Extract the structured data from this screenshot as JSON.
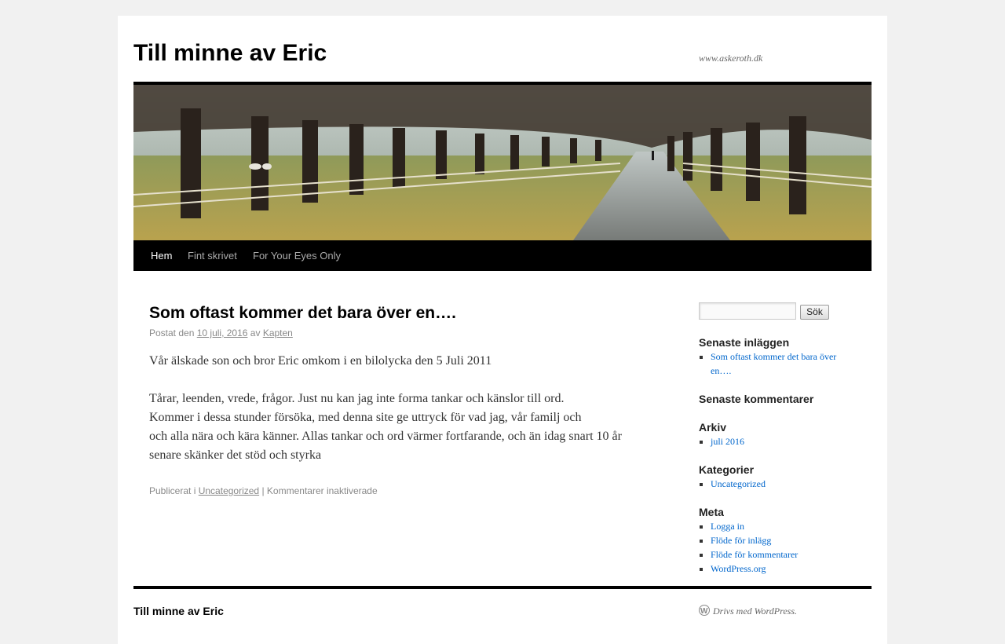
{
  "header": {
    "site_title": "Till minne av Eric",
    "site_description": "www.askeroth.dk",
    "banner_icon": "header-image"
  },
  "nav": {
    "items": [
      {
        "label": "Hem",
        "current": true
      },
      {
        "label": "Fint skrivet",
        "current": false
      },
      {
        "label": "For Your Eyes Only",
        "current": false
      }
    ]
  },
  "post": {
    "title": "Som oftast kommer det bara över en….",
    "meta_prefix": "Postat den",
    "date": "10 juli, 2016",
    "meta_by": "av",
    "author": "Kapten",
    "paragraphs": [
      "Vår älskade son och bror Eric omkom i en bilolycka den 5 Juli 2011",
      "Tårar, leenden, vrede, frågor. Just nu kan jag inte forma tankar och känslor till ord.",
      "Kommer i dessa stunder försöka, med denna site ge uttryck för vad jag, vår familj och",
      "och alla nära och kära känner. Allas tankar och ord värmer fortfarande, och än idag snart 10 år",
      "senare skänker det stöd och styrka"
    ],
    "utility_prefix": "Publicerat i",
    "category": "Uncategorized",
    "separator": "|",
    "comments_status": "Kommentarer inaktiverade"
  },
  "sidebar": {
    "search": {
      "value": "",
      "button_label": "Sök"
    },
    "recent_posts": {
      "title": "Senaste inläggen",
      "items": [
        "Som oftast kommer det bara över en…."
      ]
    },
    "recent_comments": {
      "title": "Senaste kommentarer"
    },
    "archive": {
      "title": "Arkiv",
      "items": [
        "juli 2016"
      ]
    },
    "categories": {
      "title": "Kategorier",
      "items": [
        "Uncategorized"
      ]
    },
    "meta": {
      "title": "Meta",
      "items": [
        "Logga in",
        "Flöde för inlägg",
        "Flöde för kommentarer",
        "WordPress.org"
      ]
    }
  },
  "footer": {
    "site_title": "Till minne av Eric",
    "powered_by": "Drivs med WordPress.",
    "powered_icon": "wordpress-icon"
  },
  "colors": {
    "link": "#0066cc",
    "nav_bg": "#000000",
    "page_bg": "#f1f1f1"
  }
}
